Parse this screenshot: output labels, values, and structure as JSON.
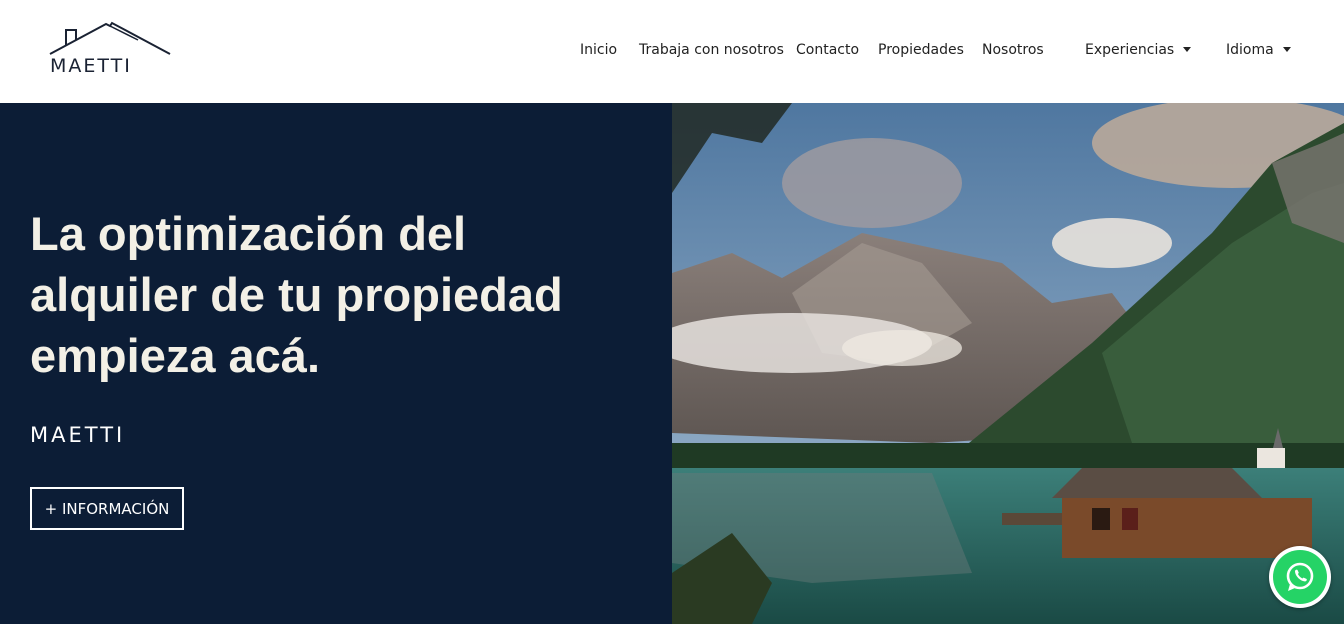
{
  "header": {
    "logo_text": "MAETTI",
    "nav": [
      {
        "label": "Inicio"
      },
      {
        "label": "Trabaja con nosotros"
      },
      {
        "label": "Contacto"
      },
      {
        "label": "Propiedades"
      },
      {
        "label": "Nosotros"
      },
      {
        "label": "Experiencias",
        "dropdown": true
      },
      {
        "label": "Idioma",
        "dropdown": true
      }
    ]
  },
  "hero": {
    "title": "La optimización del alquiler de tu propiedad empieza acá.",
    "brand": "MAETTI",
    "button_label": "+ INFORMACIÓN",
    "image": "mountain-lake-boathouse-photo"
  },
  "floating": {
    "icon": "whatsapp-icon"
  },
  "colors": {
    "hero_bg": "#0c1d36",
    "title_text": "#f3f0e6",
    "whatsapp": "#25d366"
  }
}
